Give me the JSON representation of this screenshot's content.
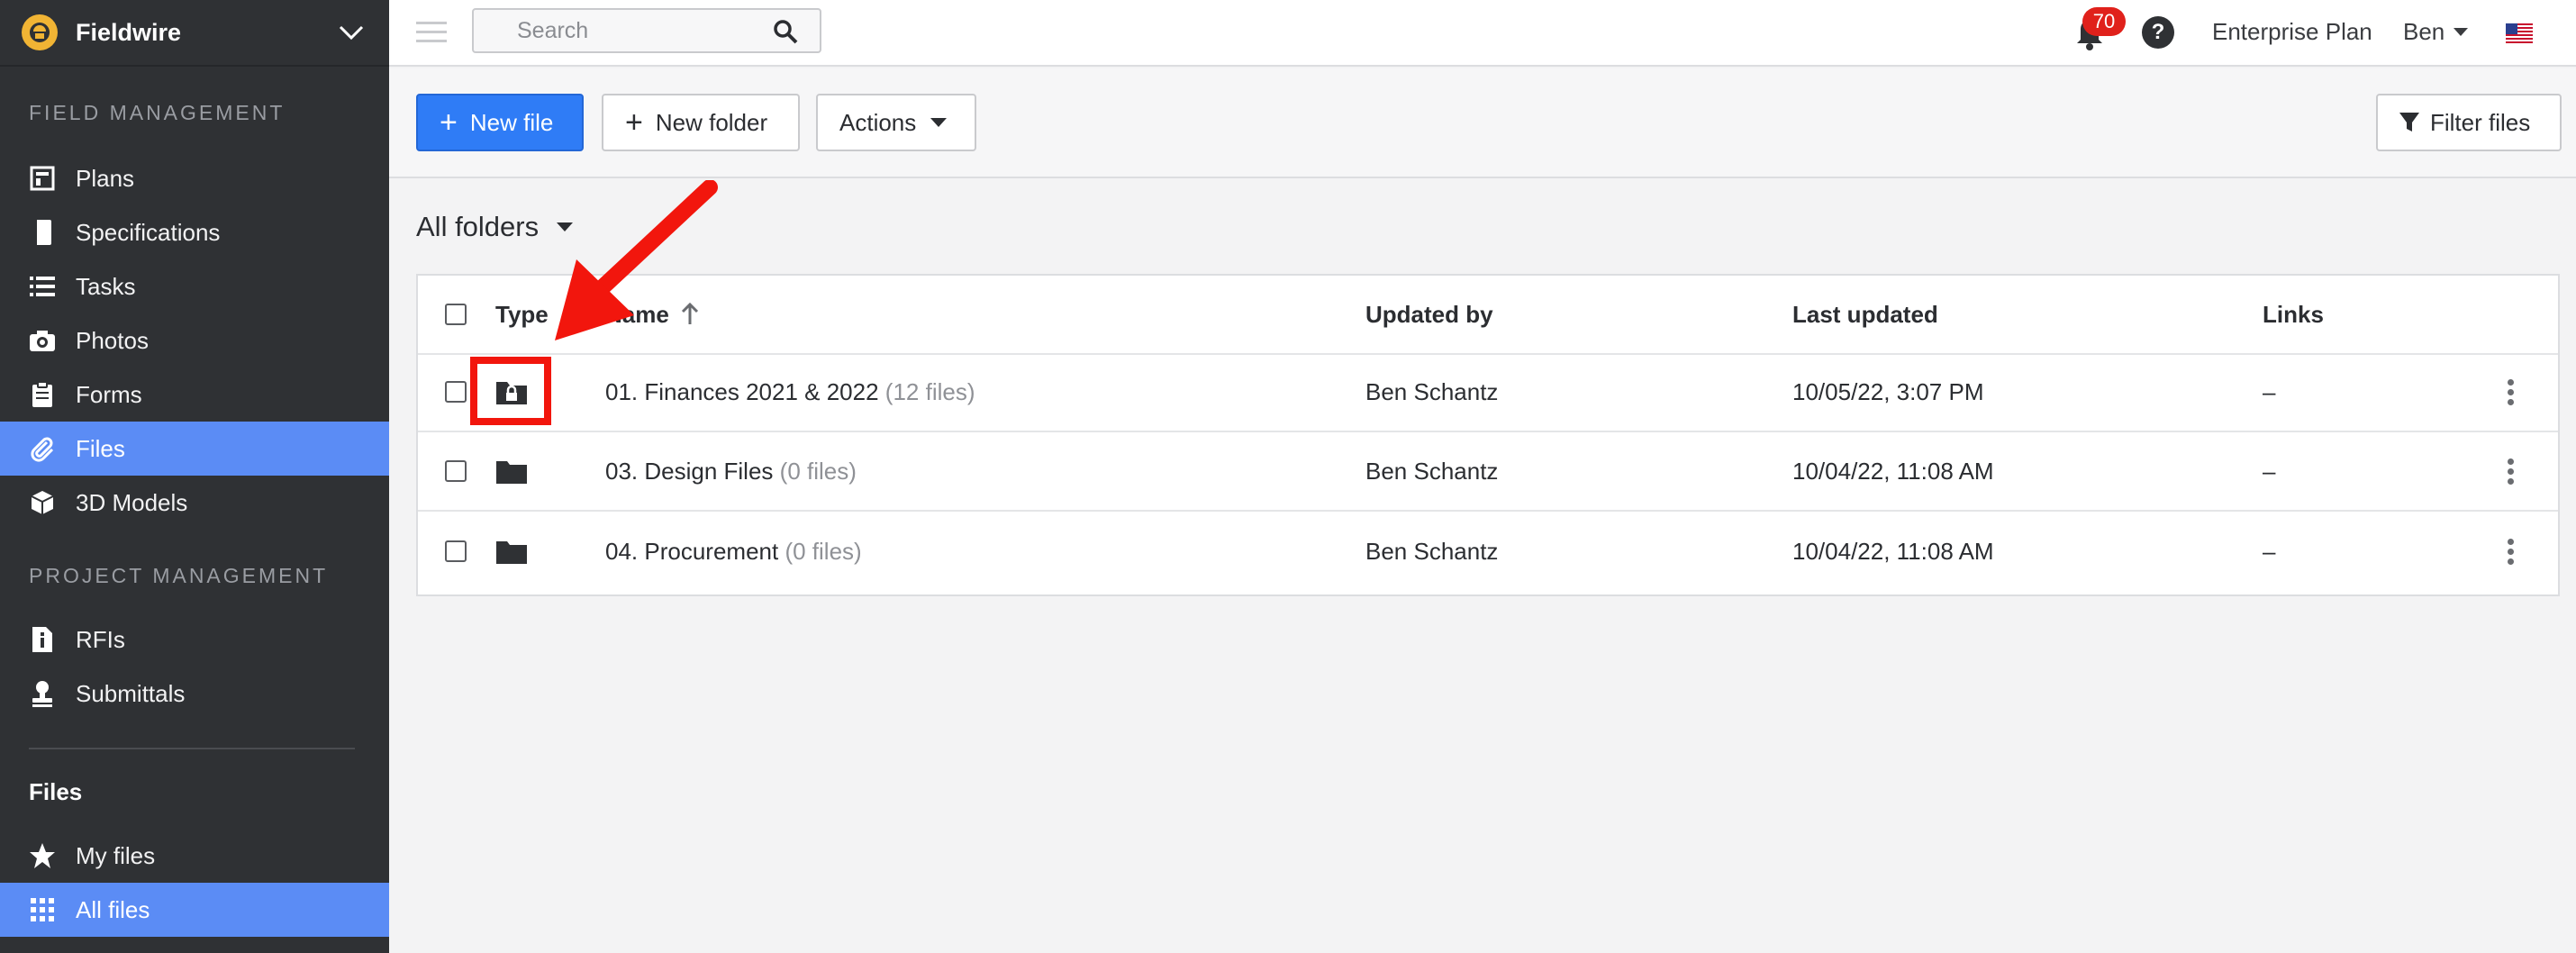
{
  "app": {
    "name": "Fieldwire"
  },
  "sidebar": {
    "section_field": "FIELD MANAGEMENT",
    "section_project": "PROJECT MANAGEMENT",
    "field_items": [
      {
        "label": "Plans",
        "icon": "plans-icon"
      },
      {
        "label": "Specifications",
        "icon": "book-icon"
      },
      {
        "label": "Tasks",
        "icon": "list-icon"
      },
      {
        "label": "Photos",
        "icon": "camera-icon"
      },
      {
        "label": "Forms",
        "icon": "clipboard-icon"
      },
      {
        "label": "Files",
        "icon": "paperclip-icon",
        "active": true
      },
      {
        "label": "3D Models",
        "icon": "cube-icon"
      }
    ],
    "project_items": [
      {
        "label": "RFIs",
        "icon": "document-info-icon"
      },
      {
        "label": "Submittals",
        "icon": "stamp-icon"
      }
    ],
    "files_heading": "Files",
    "files_items": [
      {
        "label": "My files",
        "icon": "star-icon"
      },
      {
        "label": "All files",
        "icon": "grid-icon",
        "active": true
      }
    ],
    "accent_color": "#5b8cf5"
  },
  "topbar": {
    "search_placeholder": "Search",
    "notification_count": "70",
    "help_label": "?",
    "plan": "Enterprise Plan",
    "user": "Ben"
  },
  "toolbar": {
    "new_file": "New file",
    "new_folder": "New folder",
    "actions": "Actions",
    "filter": "Filter files"
  },
  "content": {
    "breadcrumb": "All folders",
    "columns": {
      "type": "Type",
      "name": "Name",
      "updated_by": "Updated by",
      "last_updated": "Last updated",
      "links": "Links"
    },
    "rows": [
      {
        "name": "01. Finances 2021 & 2022",
        "count": "(12 files)",
        "updated_by": "Ben Schantz",
        "last_updated": "10/05/22, 3:07 PM",
        "links": "–",
        "icon": "locked-folder-icon"
      },
      {
        "name": "03. Design Files",
        "count": "(0 files)",
        "updated_by": "Ben Schantz",
        "last_updated": "10/04/22, 11:08 AM",
        "links": "–",
        "icon": "folder-icon"
      },
      {
        "name": "04. Procurement",
        "count": "(0 files)",
        "updated_by": "Ben Schantz",
        "last_updated": "10/04/22, 11:08 AM",
        "links": "–",
        "icon": "folder-icon"
      }
    ]
  },
  "annotation_color": "#f2160d"
}
